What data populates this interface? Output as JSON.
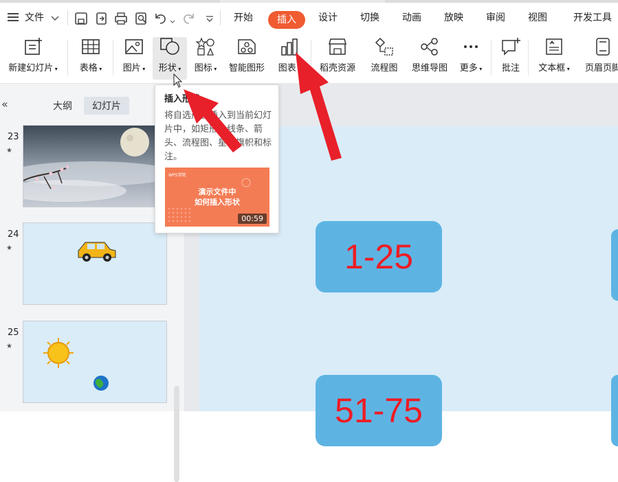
{
  "menubar": {
    "file_label": "文件",
    "tabs": [
      "开始",
      "插入",
      "设计",
      "切换",
      "动画",
      "放映",
      "审阅",
      "视图",
      "开发工具"
    ],
    "active_tab": "插入"
  },
  "ribbon": {
    "items": [
      "新建幻灯片",
      "表格",
      "图片",
      "形状",
      "图标",
      "智能图形",
      "图表",
      "稻壳资源",
      "流程图",
      "思维导图",
      "更多",
      "批注",
      "文本框",
      "页眉页脚"
    ]
  },
  "leftpane": {
    "tab_outline": "大纲",
    "tab_slides": "幻灯片",
    "slides": [
      {
        "number": "23"
      },
      {
        "number": "24"
      },
      {
        "number": "25"
      }
    ]
  },
  "slide": {
    "box1": "1-25",
    "box2": "51-75"
  },
  "tooltip": {
    "title": "插入形状",
    "description": "将自选形状插入到当前幻灯片中，如矩形、线条、箭头、流程图、星与旗帜和标注。",
    "video_title_line1": "演示文件中",
    "video_title_line2": "如何插入形状",
    "video_duration": "00:59",
    "video_logo": "WPS学院"
  },
  "colors": {
    "accent": "#f05b31",
    "arrow": "#e8202a",
    "box": "#5db4e3",
    "box_text": "#ee1c24"
  }
}
